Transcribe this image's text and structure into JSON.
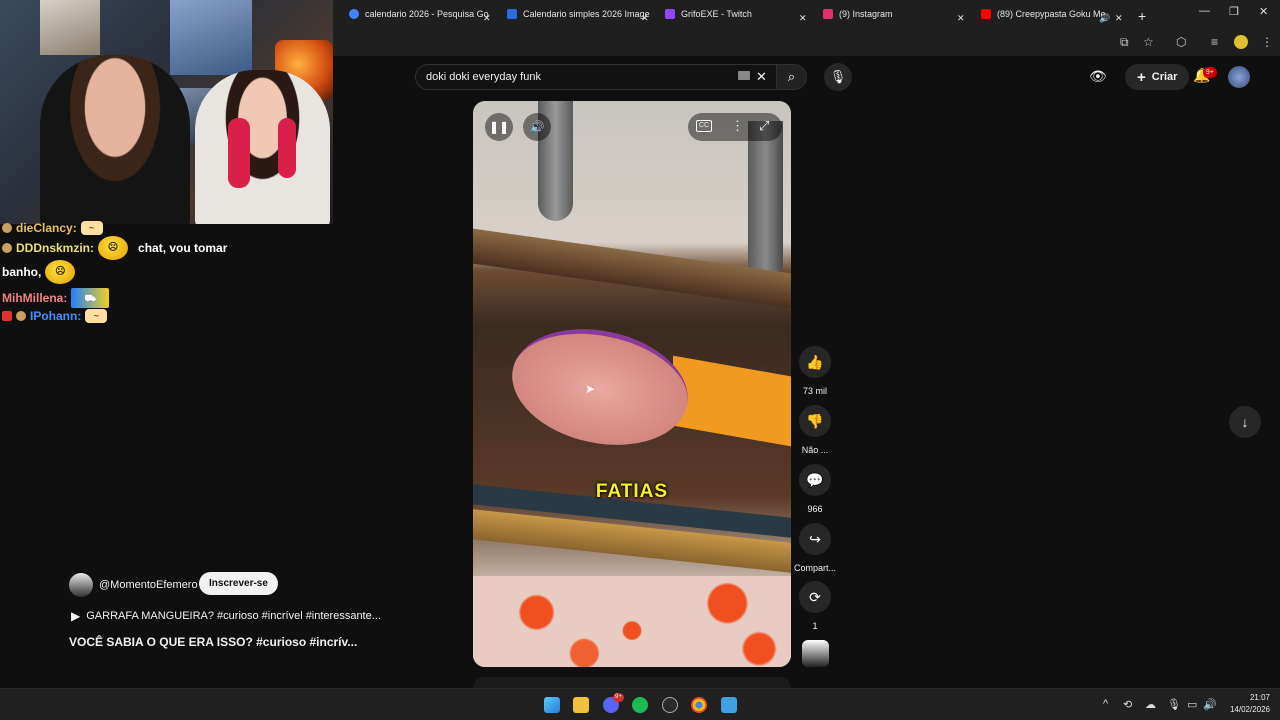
{
  "stream_chat": [
    {
      "user": "dieClancy:",
      "message": ""
    },
    {
      "user": "DDDnskmzin:",
      "message": "chat, vou tomar"
    },
    {
      "user": "banho,",
      "message": ""
    },
    {
      "user": "MihMillena:",
      "message": ""
    },
    {
      "user": "IPohann:",
      "message": ""
    }
  ],
  "browser": {
    "tabs": [
      {
        "label": "calendario 2026 - Pesquisa Go",
        "icon": "google-icon",
        "color": "#4285f4"
      },
      {
        "label": "Calendario simples 2026 Image",
        "icon": "docs-icon",
        "color": "#2a6be0"
      },
      {
        "label": "GrifoEXE - Twitch",
        "icon": "twitch-icon",
        "color": "#9146ff"
      },
      {
        "label": "(9) Instagram",
        "icon": "instagram-icon",
        "color": "#e1306c"
      },
      {
        "label": "(89) Creepypasta Goku Me",
        "icon": "youtube-icon",
        "color": "#ff0000"
      }
    ]
  },
  "youtube": {
    "search_query": "doki doki everyday funk",
    "create_label": "Criar",
    "notification_count": "9+",
    "video_caption": "FATIAS",
    "actions": {
      "likes": "73 mil",
      "dislike": "Não ...",
      "comments": "966",
      "share": "Compart...",
      "remix": "1"
    },
    "channel": "@MomentoEfemero",
    "subscribe_label": "Inscrever-se",
    "related_link": "GARRAFA MANGUEIRA? #curioso #incrível #interessante...",
    "video_title": "VOCÊ SABIA O QUE ERA ISSO? #curioso #incrív..."
  },
  "taskbar": {
    "time": "21:07",
    "date": "14/02/2026",
    "discord_badge": "9+"
  }
}
